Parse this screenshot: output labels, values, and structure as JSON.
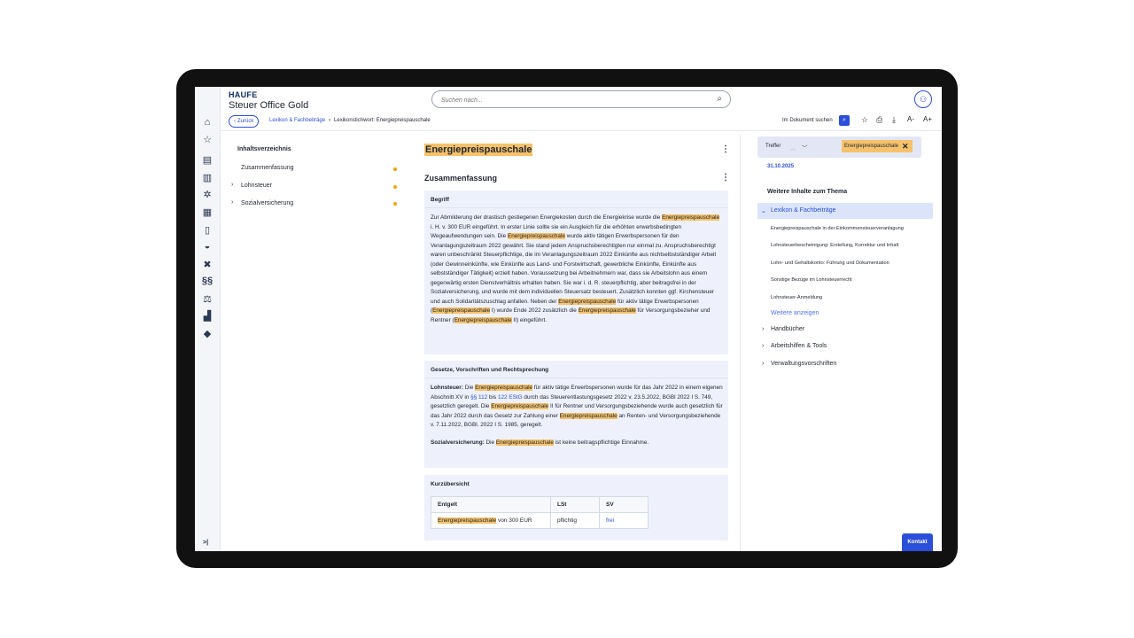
{
  "header": {
    "logo": "HAUFE",
    "product": "Steuer Office Gold",
    "search_placeholder": "Suchen nach..."
  },
  "toolbar": {
    "back_label": "Zurück",
    "breadcrumb": [
      "Lexikon & Fachbeiträge",
      "Lexikonstichwort: Energiepreispauschale"
    ],
    "doc_search_label": "Im Dokument suchen",
    "font_down": "A-",
    "font_up": "A+"
  },
  "toc": {
    "title": "Inhaltsverzeichnis",
    "items": [
      "Zusammenfassung",
      "Lohnsteuer",
      "Sozialversicherung"
    ]
  },
  "main": {
    "title": "Energiepreispauschale",
    "section_title": "Zusammenfassung",
    "begriff": {
      "heading": "Begriff",
      "p1": "Zur Abmilderung der drastisch gestiegenen Energiekosten durch die Energiekrise wurde die",
      "h1": "Energiepreispauschale",
      "p2": " i. H. v. 300 EUR eingeführt. In erster Linie sollte sie ein Ausgleich für die erhöhten erwerbsbedingten Wegeaufwendungen sein. Die ",
      "h2": "Energiepreispauschale",
      "p3": " wurde aktiv tätigen Erwerbspersonen für den Veranlagungszeitraum 2022 gewährt. Sie stand jedem Anspruchsberechtigten nur einmal zu. Anspruchsberechtigt waren unbeschränkt Steuerpflichtige, die im Veranlagungszeitraum 2022 Einkünfte aus nichtselbstständiger Arbeit (oder Gewinneinkünfte, wie Einkünfte aus Land- und Forstwirtschaft, gewerbliche Einkünfte, Einkünfte aus selbstständiger Tätigkeit) erzielt haben. Voraussetzung bei Arbeitnehmern war, dass sie Arbeitslohn aus einem gegenwärtig ersten Dienstverhältnis erhalten haben. Sie war i. d. R. steuerpflichtig, aber beitragsfrei in der Sozialversicherung, und wurde mit dem individuellen Steuersatz besteuert. Zusätzlich konnten ggf. Kirchensteuer und auch Solidaritätszuschlag anfallen. Neben der ",
      "h3": "Energiepreispauschale",
      "p4": " für aktiv tätige Erwerbspersonen (",
      "h4": "Energiepreispauschale",
      "p5": " I) wurde Ende 2022 zusätzlich die ",
      "h5": "Energiepreispauschale",
      "p6": " für Versorgungsbezieher und Rentner (",
      "h6": "Energiepreispauschale",
      "p7": " II) eingeführt."
    },
    "gesetze": {
      "heading": "Gesetze, Vorschriften und Rechtsprechung",
      "ls_label": "Lohnsteuer:",
      "a1": " Die ",
      "h1": "Energiepreispauschale",
      "a2": " für aktiv tätige Erwerbspersonen wurde für das Jahr 2022 in einem eigenen Abschnitt XV in ",
      "l1": "§§ 112",
      "a3": " bis ",
      "l2": "122 EStG",
      "a4": " durch das Steuerentlastungsgesetz 2022 v. 23.5.2022, BGBl 2022 I S. 749, gesetzlich geregelt. Die ",
      "h2": "Energiepreispauschale",
      "a5": " II für Rentner und Versorgungsbeziehende wurde auch gesetzlich für das Jahr 2022 durch das Gesetz zur Zahlung einer ",
      "h3": "Energiepreispauschale",
      "a6": " an Renten- und Versorgungsbeziehende v. 7.11.2022, BGBl. 2022 I S. 1985, geregelt.",
      "sv_label": "Sozialversicherung:",
      "b1": " Die ",
      "h4": "Energiepreispauschale",
      "b2": " ist keine beitragspflichtige Einnahme."
    },
    "kurz": {
      "heading": "Kurzübersicht",
      "columns": [
        "Entgelt",
        "LSt",
        "SV"
      ],
      "row_hl": "Energiepreispauschale",
      "row_rest": " von 300 EUR",
      "row_lst": "pflichtig",
      "row_sv": "frei"
    }
  },
  "right": {
    "treffer_label": "Treffer",
    "tag": "Energiepreispauschale",
    "date": "31.10.2025",
    "more_title": "Weitere Inhalte zum Thema",
    "open_section": "Lexikon & Fachbeiträge",
    "links": [
      "Energiepreispauschale in der Einkommensteuerveranlagung",
      "Lohnsteuerbescheinigung: Erstellung, Korrektur und Inhalt",
      "Lohn- und Gehaltskonto: Führung und Dokumentation",
      "Sonstige Bezüge im Lohnsteuerrecht",
      "Lohnsteuer-Anmeldung"
    ],
    "show_more": "Weitere anzeigen",
    "sections": [
      "Handbücher",
      "Arbeitshilfen & Tools",
      "Verwaltungsvorschriften"
    ],
    "contact": "Kontakt"
  }
}
